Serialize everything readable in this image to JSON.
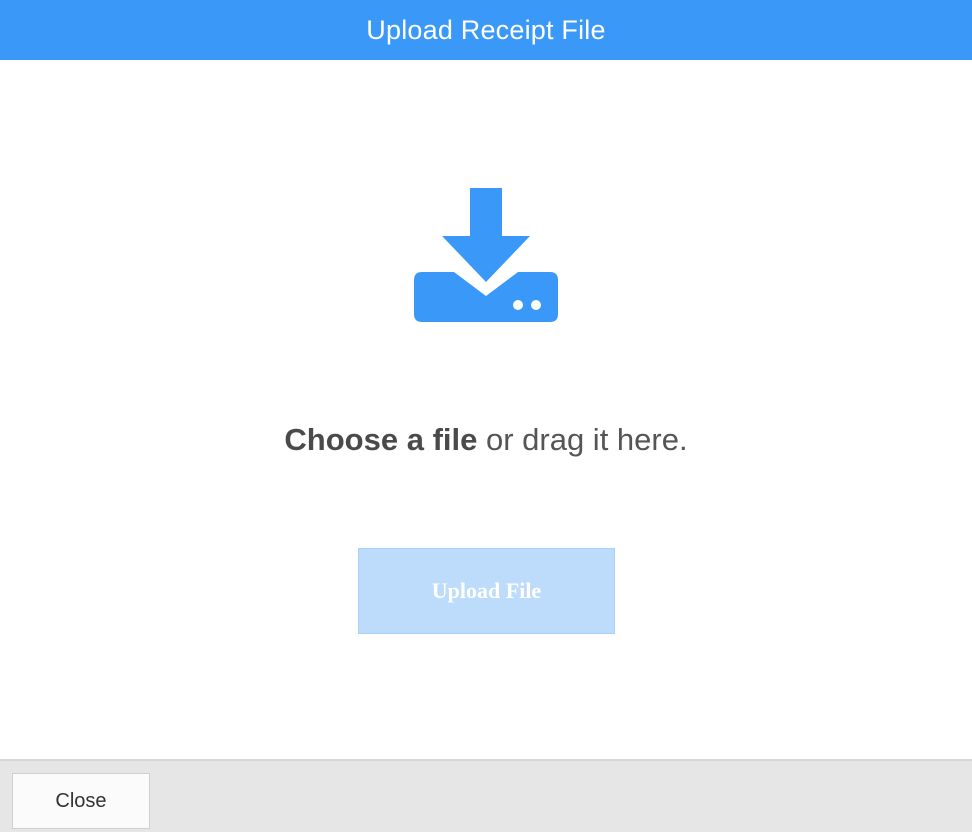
{
  "dialog": {
    "title": "Upload Receipt File"
  },
  "dropzone": {
    "icon": "download-tray-icon",
    "prompt_strong": "Choose a file",
    "prompt_rest": " or drag it here.",
    "upload_button_label": "Upload File",
    "upload_button_enabled": false
  },
  "footer": {
    "close_label": "Close"
  },
  "colors": {
    "accent": "#3a99f8",
    "button_disabled": "#bddcfb",
    "footer_bg": "#e6e6e6"
  }
}
